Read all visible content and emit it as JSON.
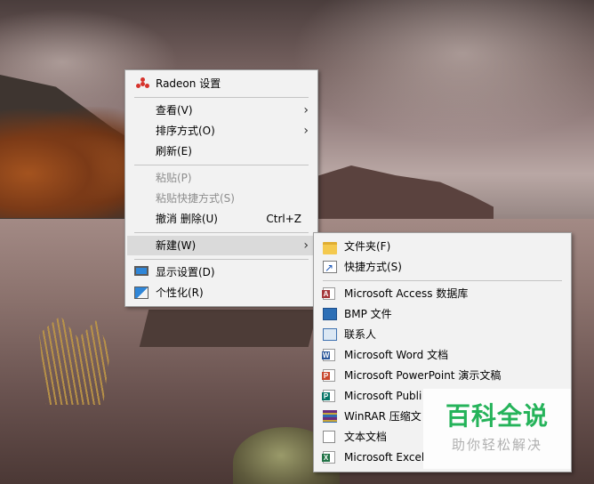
{
  "main_menu": {
    "items": [
      {
        "label": "Radeon 设置"
      },
      {
        "label": "查看(V)"
      },
      {
        "label": "排序方式(O)"
      },
      {
        "label": "刷新(E)"
      },
      {
        "label": "粘贴(P)"
      },
      {
        "label": "粘贴快捷方式(S)"
      },
      {
        "label": "撤消 删除(U)",
        "shortcut": "Ctrl+Z"
      },
      {
        "label": "新建(W)"
      },
      {
        "label": "显示设置(D)"
      },
      {
        "label": "个性化(R)"
      }
    ]
  },
  "submenu": {
    "items": [
      {
        "label": "文件夹(F)"
      },
      {
        "label": "快捷方式(S)"
      },
      {
        "label": "Microsoft Access 数据库"
      },
      {
        "label": "BMP 文件"
      },
      {
        "label": "联系人"
      },
      {
        "label": "Microsoft Word 文档"
      },
      {
        "label": "Microsoft PowerPoint 演示文稿"
      },
      {
        "label": "Microsoft Publi"
      },
      {
        "label": "WinRAR 压缩文"
      },
      {
        "label": "文本文档"
      },
      {
        "label": "Microsoft Excel "
      }
    ]
  },
  "watermark": {
    "title": "百科全说",
    "subtitle": "助你轻松解决"
  },
  "colors": {
    "menu_bg": "#f2f2f2",
    "highlight": "#dadada",
    "radeon": "#d6332c",
    "watermark_green": "#25b35a"
  }
}
